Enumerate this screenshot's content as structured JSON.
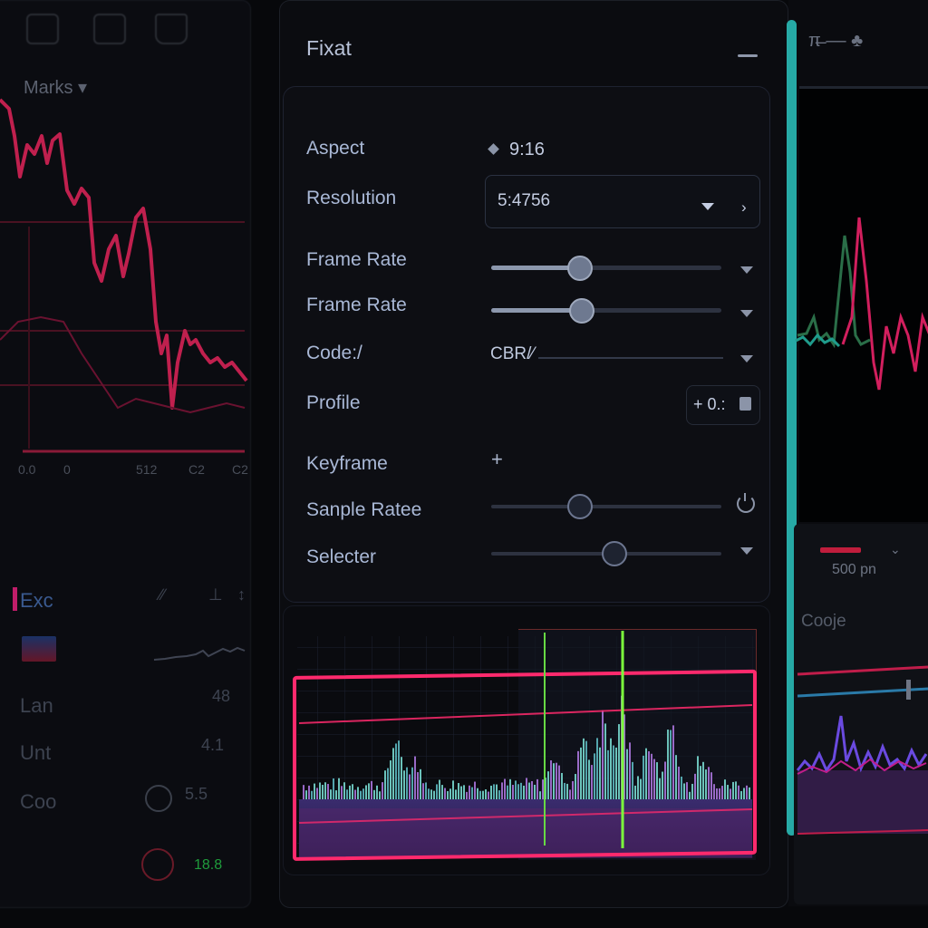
{
  "left_panel": {
    "menu_label": "Marks ▾",
    "ticks": [
      "0.0",
      "0",
      "512",
      "C2",
      "C2"
    ],
    "rows": [
      "Exc",
      "Lan",
      "Unt",
      "Coo"
    ],
    "mini": [
      "∕∕",
      "⊥",
      "↕",
      "48",
      "4.1",
      "5.5"
    ],
    "status_readout": "18.8"
  },
  "panel": {
    "title": "Fixat"
  },
  "settings": {
    "aspect": {
      "label": "Aspect",
      "value": "9:16"
    },
    "resolution": {
      "label": "Resolution",
      "value": "5:4756",
      "next": "›"
    },
    "frame_rate_1": {
      "label": "Frame Rate",
      "level": 0.38
    },
    "frame_rate_2": {
      "label": "Frame Rate",
      "level": 0.39
    },
    "codec": {
      "label": "Code:/",
      "value": "CBR/⁄"
    },
    "profile": {
      "label": "Profile",
      "value": "+ 0.:"
    },
    "keyframe": {
      "label": "Keyframe",
      "add": "+"
    },
    "sample_rate": {
      "label": "Sanple Ratee",
      "level": 0.38
    },
    "selecter": {
      "label": "Selecter",
      "level": 0.53
    }
  },
  "right_panel": {
    "toolbar_label": "π̶̶ ‒‒ ♣",
    "time_readout": "500 pn",
    "label2": "Cooje"
  },
  "colors": {
    "accent_teal": "#2cc5c0",
    "wave_pink": "#ff2a6d",
    "wave_purple": "#b27ae6",
    "wave_cyan": "#7de3d8",
    "marker_green": "#7cff3c"
  },
  "icons": [
    "home-icon",
    "clipboard-icon",
    "bell-icon",
    "chevron-down-icon",
    "power-icon",
    "lock-icon",
    "plus-icon",
    "diamond-icon"
  ]
}
